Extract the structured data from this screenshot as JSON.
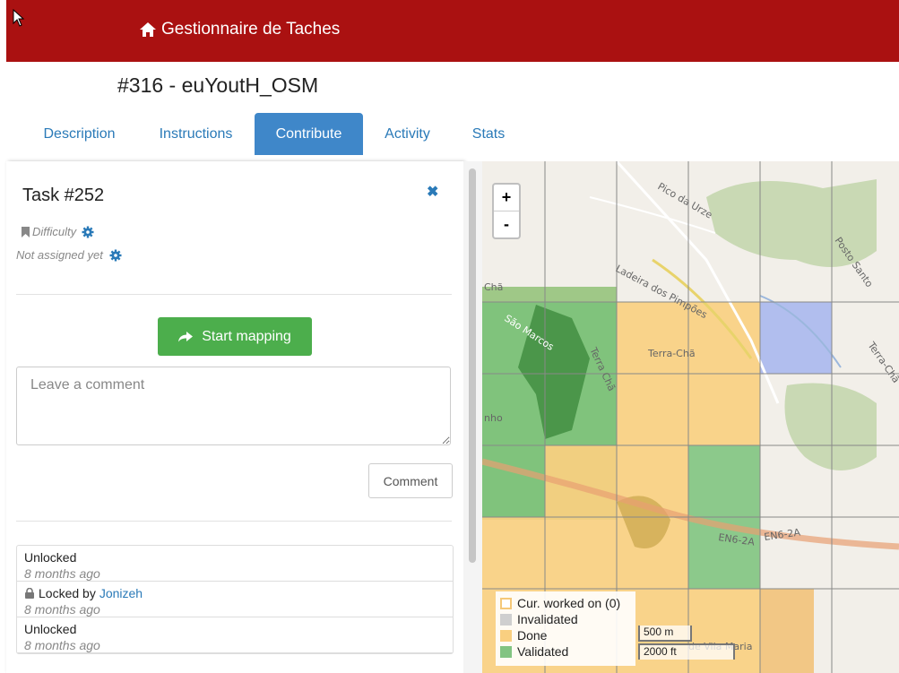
{
  "app": {
    "title": "Gestionnaire de Taches"
  },
  "project": {
    "title": "#316 - euYoutH_OSM"
  },
  "tabs": [
    {
      "label": "Description",
      "active": false
    },
    {
      "label": "Instructions",
      "active": false
    },
    {
      "label": "Contribute",
      "active": true
    },
    {
      "label": "Activity",
      "active": false
    },
    {
      "label": "Stats",
      "active": false
    }
  ],
  "task": {
    "title": "Task #252",
    "difficulty_label": "Difficulty",
    "assignment": "Not assigned yet",
    "start_button": "Start mapping",
    "comment_placeholder": "Leave a comment",
    "comment_button": "Comment"
  },
  "history": [
    {
      "action": "Unlocked",
      "user": "",
      "time": "8 months ago",
      "locked": false
    },
    {
      "action": "Locked by",
      "user": "Jonizeh",
      "time": "8 months ago",
      "locked": true
    },
    {
      "action": "Unlocked",
      "user": "",
      "time": "8 months ago",
      "locked": false
    }
  ],
  "map": {
    "zoom_in": "+",
    "zoom_out": "-",
    "labels": [
      "Pico da Urze",
      "Posto Santo",
      "Ladeira dos Pimpões",
      "Chã",
      "São Marcos",
      "Terra Chã",
      "Terra-Chã",
      "Terra-Chã",
      "nho",
      "EN6-2A",
      "EN6-2A",
      "de Vila Maria"
    ],
    "legend": [
      {
        "label": "Cur. worked on (0)",
        "color": "#ffffff",
        "border": "#f5c878"
      },
      {
        "label": "Invalidated",
        "color": "#cfcfcf",
        "border": "#cfcfcf"
      },
      {
        "label": "Done",
        "color": "#f9cf80",
        "border": "#f9cf80"
      },
      {
        "label": "Validated",
        "color": "#82c482",
        "border": "#82c482"
      }
    ],
    "scale": [
      "500 m",
      "2000 ft"
    ],
    "colors": {
      "done": "#f9cf80",
      "validated": "#7ac27a",
      "selected": "#aab8ee",
      "grid": "#888888"
    }
  }
}
